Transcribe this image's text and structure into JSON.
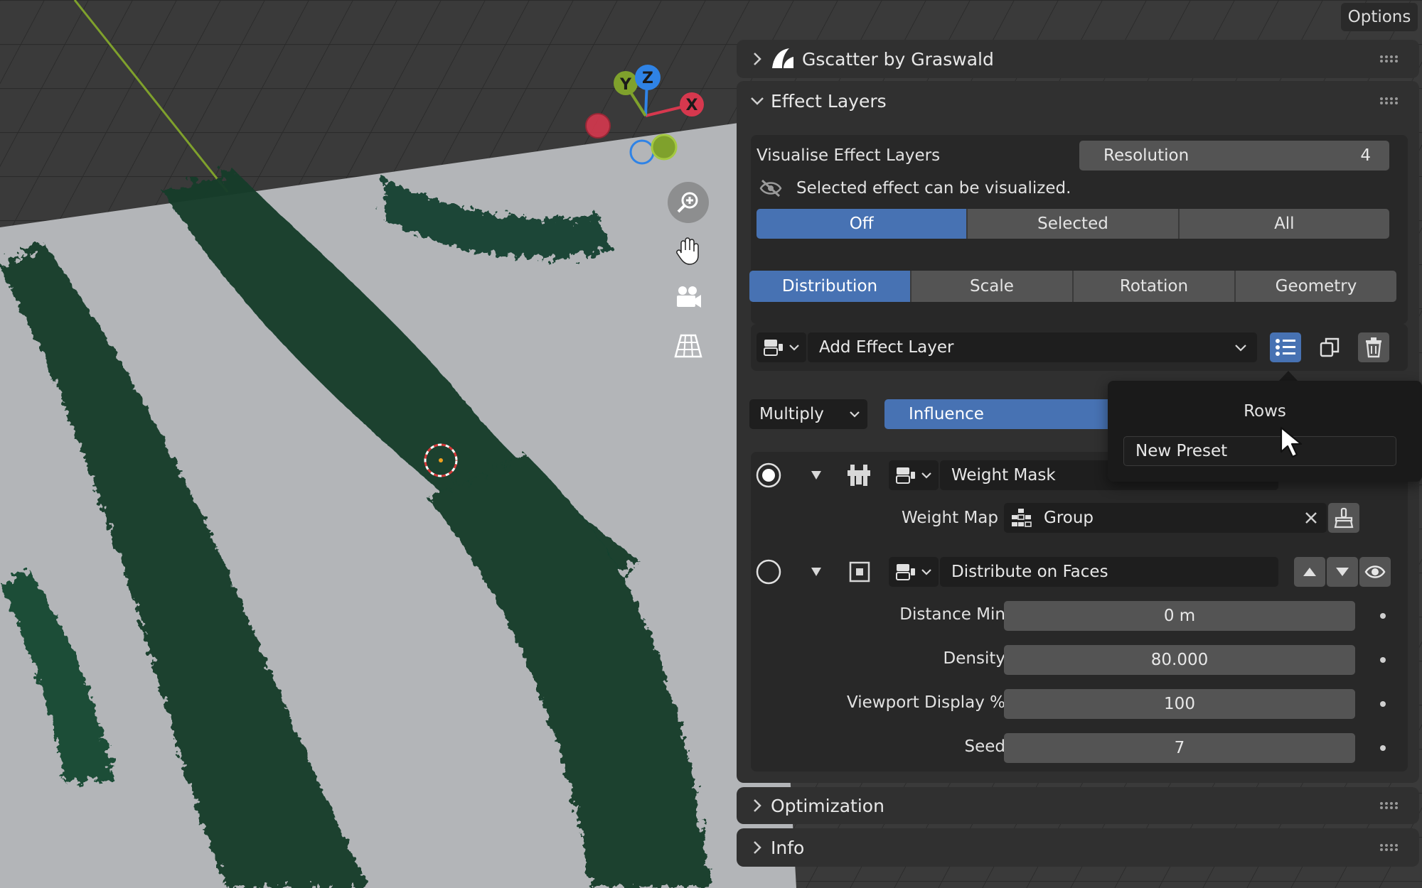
{
  "toolbar": {
    "options_label": "Options"
  },
  "gizmo": {
    "x_label": "X",
    "y_label": "Y",
    "z_label": "Z"
  },
  "panels": {
    "gscatter": {
      "title": "Gscatter by Graswald"
    },
    "effect_layers": {
      "title": "Effect Layers"
    },
    "optimization": {
      "title": "Optimization"
    },
    "info": {
      "title": "Info"
    }
  },
  "visualise": {
    "label": "Visualise Effect Layers",
    "resolution_label": "Resolution",
    "resolution_value": "4",
    "status_text": "Selected effect can be visualized.",
    "modes": [
      "Off",
      "Selected",
      "All"
    ],
    "active_mode": "Off"
  },
  "tabs": [
    "Distribution",
    "Scale",
    "Rotation",
    "Geometry"
  ],
  "active_tab": "Distribution",
  "add_effect": {
    "label": "Add Effect Layer"
  },
  "blend": {
    "mode": "Multiply",
    "influence_label": "Influence"
  },
  "popup": {
    "title": "Rows",
    "preset_label": "New Preset"
  },
  "layers": [
    {
      "name": "Weight Mask",
      "weight_map_label": "Weight Map",
      "weight_map_value": "Group"
    },
    {
      "name": "Distribute on Faces",
      "props": [
        {
          "label": "Distance Min",
          "value": "0 m"
        },
        {
          "label": "Density",
          "value": "80.000"
        },
        {
          "label": "Viewport Display %",
          "value": "100"
        },
        {
          "label": "Seed",
          "value": "7"
        }
      ]
    }
  ],
  "colors": {
    "accent": "#4772b3",
    "panel_bg": "#303030",
    "axis_x": "#d6384e",
    "axis_y": "#7fa12c",
    "axis_z": "#2f83e6"
  }
}
